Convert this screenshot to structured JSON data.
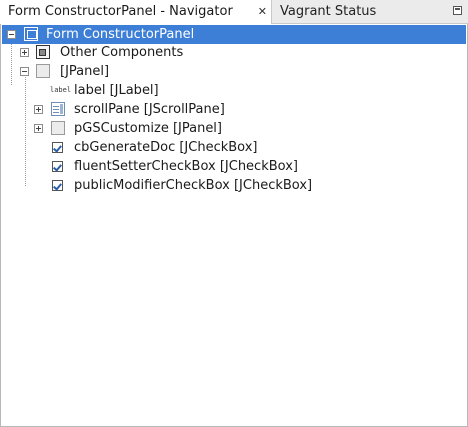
{
  "tabs": [
    {
      "label": "Form ConstructorPanel - Navigator",
      "close": "✕"
    },
    {
      "label": "Vagrant Status"
    }
  ],
  "tree": [
    {
      "label": "Form ConstructorPanel",
      "icon": "form-icon",
      "selected": true
    },
    {
      "label": "Other Components",
      "icon": "other-components-icon"
    },
    {
      "label": "[JPanel]",
      "icon": "panel-icon"
    },
    {
      "label": "label [JLabel]",
      "icon": "label-icon",
      "icon_text": "label"
    },
    {
      "label": "scrollPane [JScrollPane]",
      "icon": "scrollpane-icon"
    },
    {
      "label": "pGSCustomize [JPanel]",
      "icon": "panel-icon"
    },
    {
      "label": "cbGenerateDoc [JCheckBox]",
      "icon": "checkbox-icon"
    },
    {
      "label": "fluentSetterCheckBox [JCheckBox]",
      "icon": "checkbox-icon"
    },
    {
      "label": "publicModifierCheckBox [JCheckBox]",
      "icon": "checkbox-icon"
    }
  ],
  "colors": {
    "selection": "#3d7fd6",
    "tab_bar": "#ebebeb"
  }
}
